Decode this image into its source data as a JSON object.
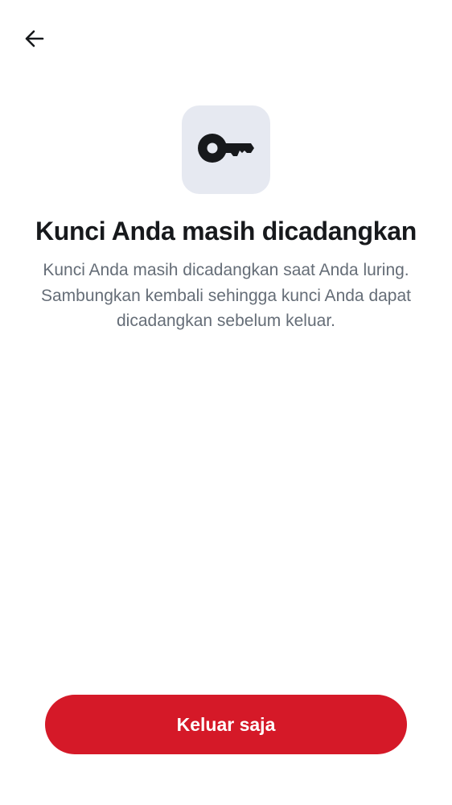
{
  "header": {
    "back_icon": "arrow-left-icon"
  },
  "hero": {
    "icon": "key-icon",
    "tile_color": "#e6e9f1",
    "title": "Kunci Anda masih dicadangkan",
    "description": "Kunci Anda masih dicadangkan saat Anda luring. Sambungkan kembali sehingga kunci Anda dapat dicadangkan sebelum keluar."
  },
  "actions": {
    "signout_label": "Keluar saja",
    "signout_color": "#d51928"
  }
}
